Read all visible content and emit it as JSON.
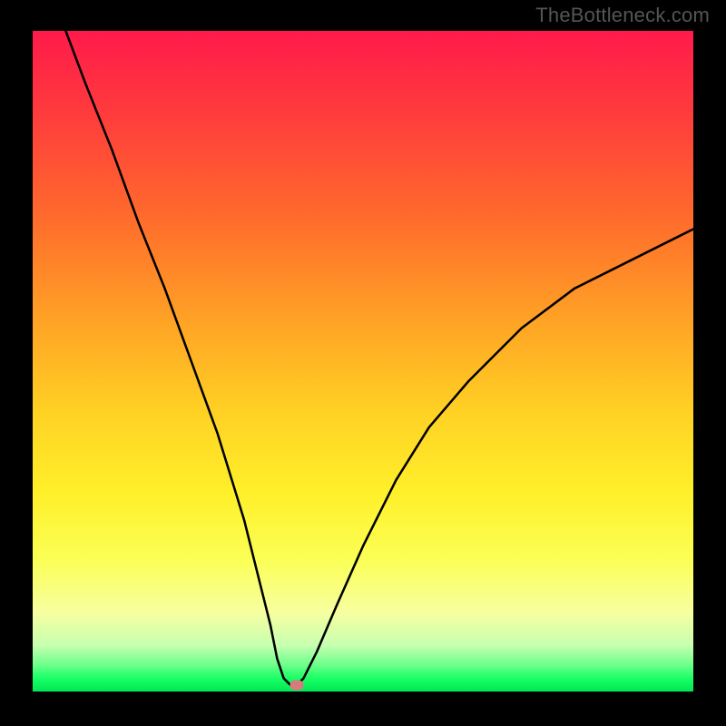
{
  "watermark": "TheBottleneck.com",
  "chart_data": {
    "type": "line",
    "title": "",
    "xlabel": "",
    "ylabel": "",
    "xlim": [
      0,
      100
    ],
    "ylim": [
      0,
      100
    ],
    "grid": false,
    "legend": false,
    "series": [
      {
        "name": "bottleneck-curve",
        "x": [
          5,
          8,
          12,
          16,
          20,
          24,
          28,
          32,
          34,
          36,
          37,
          38,
          39,
          40,
          41,
          43,
          46,
          50,
          55,
          60,
          66,
          74,
          82,
          90,
          98,
          100
        ],
        "values": [
          100,
          92,
          82,
          71,
          61,
          50,
          39,
          26,
          18,
          10,
          5,
          2,
          1,
          1,
          2,
          6,
          13,
          22,
          32,
          40,
          47,
          55,
          61,
          65,
          69,
          70
        ]
      }
    ],
    "marker": {
      "x": 40,
      "y": 1,
      "color": "#d97a7e"
    },
    "gradient": {
      "stops": [
        {
          "pos": 0,
          "color": "#ff1a4b"
        },
        {
          "pos": 12,
          "color": "#ff3a3d"
        },
        {
          "pos": 28,
          "color": "#ff6a2c"
        },
        {
          "pos": 44,
          "color": "#ffa325"
        },
        {
          "pos": 58,
          "color": "#ffd224"
        },
        {
          "pos": 70,
          "color": "#fff02a"
        },
        {
          "pos": 80,
          "color": "#fbff55"
        },
        {
          "pos": 88,
          "color": "#f7ffa0"
        },
        {
          "pos": 93,
          "color": "#c7ffb0"
        },
        {
          "pos": 96,
          "color": "#6cff8a"
        },
        {
          "pos": 98,
          "color": "#19ff66"
        },
        {
          "pos": 100,
          "color": "#00e756"
        }
      ]
    }
  }
}
